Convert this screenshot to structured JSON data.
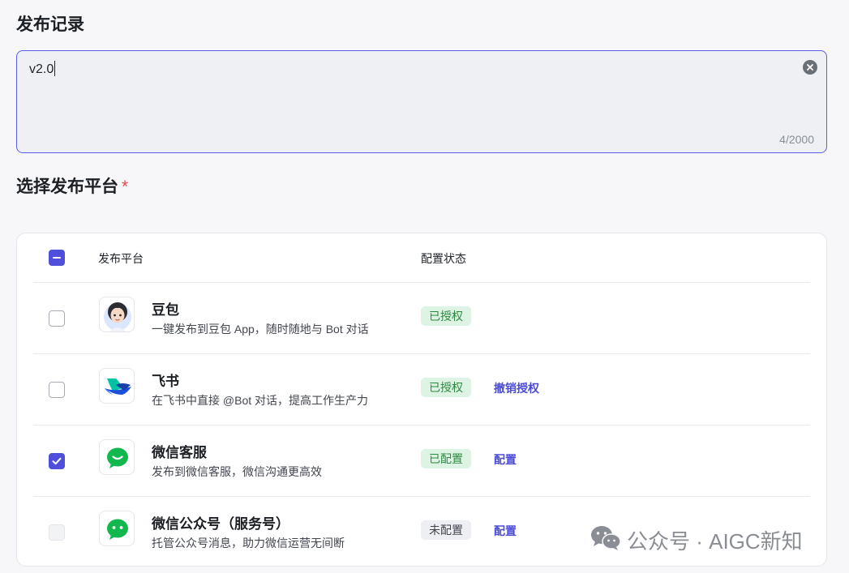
{
  "record": {
    "title": "发布记录",
    "value": "v2.0",
    "counter": "4/2000"
  },
  "platform": {
    "title": "选择发布平台",
    "required_mark": "*",
    "table": {
      "headers": {
        "platform": "发布平台",
        "status": "配置状态"
      },
      "rows": [
        {
          "name": "豆包",
          "desc": "一键发布到豆包 App，随时随地与 Bot 对话",
          "status": "已授权",
          "status_type": "ok",
          "action": "",
          "checked": false,
          "disabled": false,
          "icon": "doubao-avatar-icon"
        },
        {
          "name": "飞书",
          "desc": "在飞书中直接 @Bot 对话，提高工作生产力",
          "status": "已授权",
          "status_type": "ok",
          "action": "撤销授权",
          "checked": false,
          "disabled": false,
          "icon": "feishu-logo-icon"
        },
        {
          "name": "微信客服",
          "desc": "发布到微信客服，微信沟通更高效",
          "status": "已配置",
          "status_type": "ok",
          "action": "配置",
          "checked": true,
          "disabled": false,
          "icon": "wechat-service-icon"
        },
        {
          "name": "微信公众号（服务号）",
          "desc": "托管公众号消息，助力微信运营无间断",
          "status": "未配置",
          "status_type": "none",
          "action": "配置",
          "checked": false,
          "disabled": true,
          "icon": "wechat-official-icon"
        }
      ]
    }
  },
  "watermark": {
    "text": "公众号 · AIGC新知"
  },
  "colors": {
    "accent": "#4f4fdb",
    "ok_badge_bg": "#ddf3e4",
    "ok_badge_text": "#2b8a3e",
    "required": "#e5484d"
  }
}
